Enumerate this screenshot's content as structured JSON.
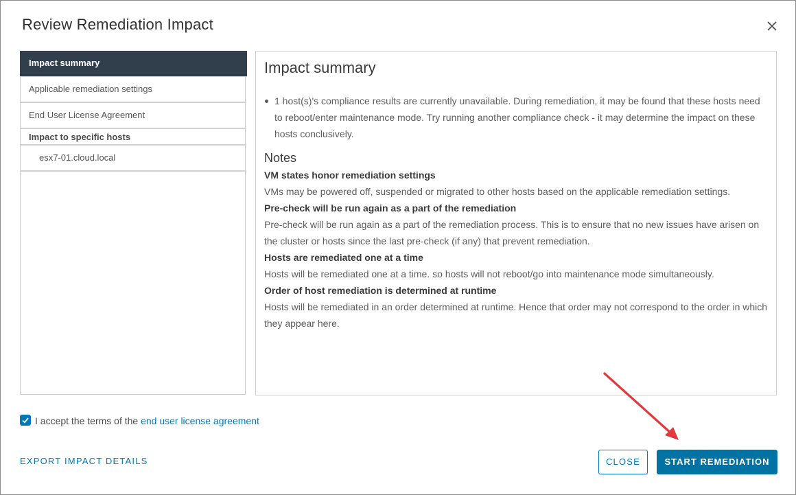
{
  "dialog": {
    "title": "Review Remediation Impact",
    "close_icon": "close-icon"
  },
  "sidebar": {
    "items": [
      {
        "label": "Impact summary",
        "active": true
      },
      {
        "label": "Applicable remediation settings"
      },
      {
        "label": "End User License Agreement"
      }
    ],
    "group_label": "Impact to specific hosts",
    "hosts": [
      "esx7-01.cloud.local"
    ]
  },
  "main": {
    "heading": "Impact summary",
    "bullets": [
      "1 host(s)'s compliance results are currently unavailable. During remediation, it may be found that these hosts need to reboot/enter maintenance mode. Try running another compliance check - it may determine the impact on these hosts conclusively."
    ],
    "notes_title": "Notes",
    "notes": [
      {
        "heading": "VM states honor remediation settings",
        "text": "VMs may be powered off, suspended or migrated to other hosts based on the applicable remediation settings."
      },
      {
        "heading": "Pre-check will be run again as a part of the remediation",
        "text": "Pre-check will be run again as a part of the remediation process. This is to ensure that no new issues have arisen on the cluster or hosts since the last pre-check (if any) that prevent remediation."
      },
      {
        "heading": "Hosts are remediated one at a time",
        "text": "Hosts will be remediated one at a time. so hosts will not reboot/go into maintenance mode simultaneously."
      },
      {
        "heading": "Order of host remediation is determined at runtime",
        "text": "Hosts will be remediated in an order determined at runtime. Hence that order may not correspond to the order in which they appear here."
      }
    ]
  },
  "eula": {
    "checked": true,
    "text_prefix": "I accept the terms of the ",
    "link_text": "end user license agreement"
  },
  "footer": {
    "export_label": "EXPORT IMPACT DETAILS",
    "close_label": "CLOSE",
    "start_label": "START REMEDIATION"
  },
  "colors": {
    "accent": "#0079b8",
    "primary_button": "#0072a3",
    "nav_active": "#313e4b",
    "annotation_arrow": "#e0393e"
  }
}
